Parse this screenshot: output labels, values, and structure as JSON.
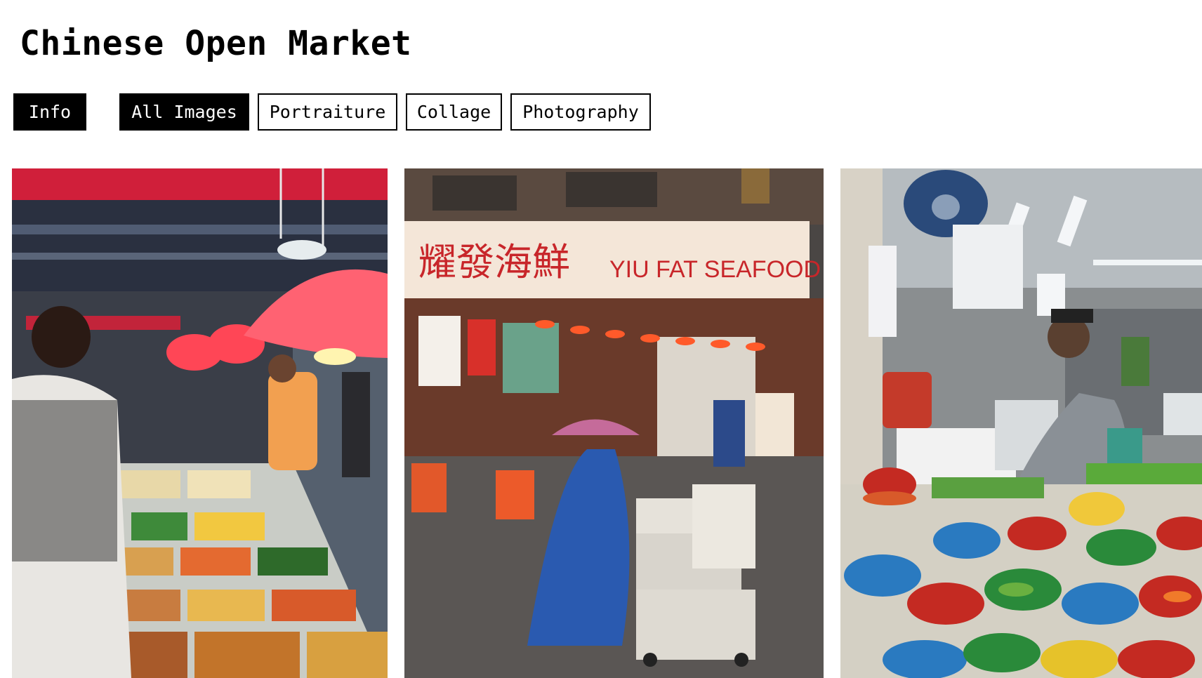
{
  "page": {
    "title": "Chinese Open Market"
  },
  "nav": {
    "info_label": "Info",
    "filters": [
      {
        "label": "All Images",
        "active": true
      },
      {
        "label": "Portraiture",
        "active": false
      },
      {
        "label": "Collage",
        "active": false
      },
      {
        "label": "Photography",
        "active": false
      }
    ]
  },
  "gallery": {
    "photos": [
      {
        "subject": "market stall with pickled vegetable trays under red lamps"
      },
      {
        "subject": "street market storefront with pedestrian pushing cart",
        "sign_text": "YIU FAT SEAFOOD",
        "sign_chinese": "耀發海鮮"
      },
      {
        "subject": "vegetable vendor with colorful bowls of produce"
      }
    ]
  },
  "colors": {
    "active_bg": "#000000",
    "active_fg": "#ffffff",
    "border": "#000000",
    "background": "#ffffff"
  }
}
